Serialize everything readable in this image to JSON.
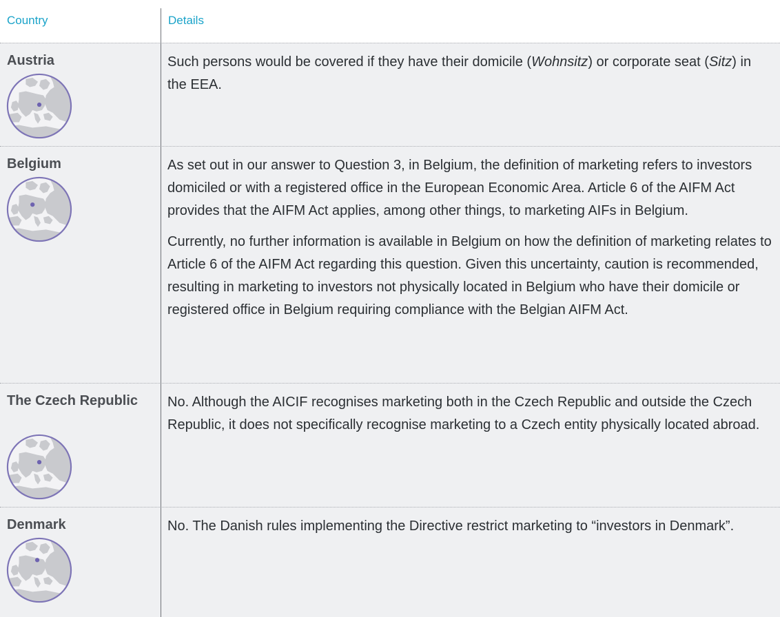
{
  "header": {
    "country": "Country",
    "details": "Details"
  },
  "rows": [
    {
      "country": "Austria",
      "paragraphs": [
        {
          "parts": [
            "Such persons would be covered if they have their domicile (",
            "Wohnsitz",
            ") or corporate seat (",
            "Sitz",
            ") in the EEA."
          ]
        }
      ]
    },
    {
      "country": "Belgium",
      "paragraphs": [
        "As set out in our answer to Question 3, in Belgium, the definition of marketing refers to investors domiciled or with a registered office in the European Economic Area. Article 6 of the AIFM Act provides that the AIFM Act applies, among other things, to marketing AIFs in Belgium.",
        "Currently, no further information is available in Belgium on how the definition of marketing relates to Article 6 of the AIFM Act regarding this question. Given this uncertainty, caution is recommended, resulting in marketing to investors not physically located in Belgium who have their domicile or registered office in Belgium requiring compliance with the Belgian AIFM Act."
      ]
    },
    {
      "country": "The Czech Republic",
      "paragraphs": [
        "No. Although the AICIF recognises marketing both in the Czech Republic and outside the Czech Republic, it does not specifically recognise marketing to a Czech entity physically located abroad."
      ]
    },
    {
      "country": "Denmark",
      "paragraphs": [
        "No. The Danish rules implementing the Directive restrict marketing to “investors in Denmark”."
      ]
    }
  ],
  "icons": {
    "globe": "europe-globe-icon"
  },
  "colors": {
    "header_text": "#1aa3c9",
    "row_background": "#eff0f2",
    "globe_fill": "#c8c9ce",
    "globe_ring": "#7d74b6",
    "marker": "#6e63b0"
  }
}
